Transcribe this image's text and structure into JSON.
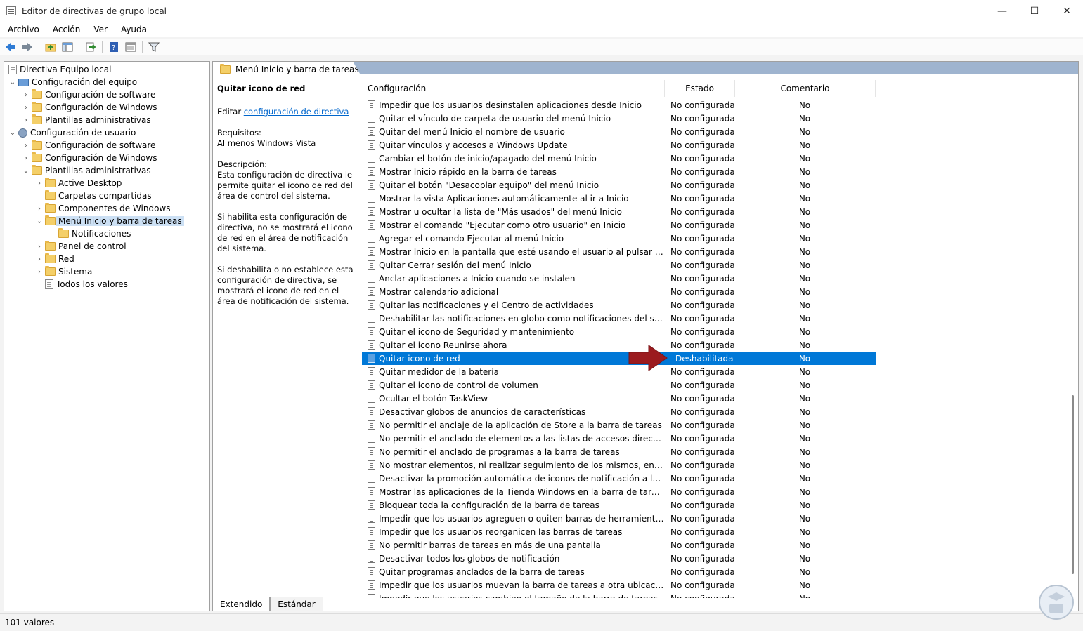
{
  "window": {
    "title": "Editor de directivas de grupo local",
    "minimize": "—",
    "maximize": "☐",
    "close": "✕"
  },
  "menu": [
    "Archivo",
    "Acción",
    "Ver",
    "Ayuda"
  ],
  "tree": [
    {
      "label": "Directiva Equipo local",
      "icon": "document-icon",
      "toggle": ""
    },
    {
      "label": "Configuración del equipo",
      "icon": "computer-icon",
      "toggle": "⌄"
    },
    {
      "label": "Configuración de software",
      "icon": "folder-icon",
      "toggle": "›"
    },
    {
      "label": "Configuración de Windows",
      "icon": "folder-icon",
      "toggle": "›"
    },
    {
      "label": "Plantillas administrativas",
      "icon": "folder-icon",
      "toggle": "›"
    },
    {
      "label": "Configuración de usuario",
      "icon": "user-icon",
      "toggle": "⌄"
    },
    {
      "label": "Configuración de software",
      "icon": "folder-icon",
      "toggle": "›"
    },
    {
      "label": "Configuración de Windows",
      "icon": "folder-icon",
      "toggle": "›"
    },
    {
      "label": "Plantillas administrativas",
      "icon": "folder-icon",
      "toggle": "⌄"
    },
    {
      "label": "Active Desktop",
      "icon": "folder-icon",
      "toggle": "›"
    },
    {
      "label": "Carpetas compartidas",
      "icon": "folder-icon",
      "toggle": ""
    },
    {
      "label": "Componentes de Windows",
      "icon": "folder-icon",
      "toggle": "›"
    },
    {
      "label": "Menú Inicio y barra de tareas",
      "icon": "folder-icon",
      "toggle": "⌄"
    },
    {
      "label": "Notificaciones",
      "icon": "folder-icon",
      "toggle": ""
    },
    {
      "label": "Panel de control",
      "icon": "folder-icon",
      "toggle": "›"
    },
    {
      "label": "Red",
      "icon": "folder-icon",
      "toggle": "›"
    },
    {
      "label": "Sistema",
      "icon": "folder-icon",
      "toggle": "›"
    },
    {
      "label": "Todos los valores",
      "icon": "settings-folder-icon",
      "toggle": ""
    }
  ],
  "panel": {
    "header": "Menú Inicio y barra de tareas",
    "setting_title": "Quitar icono de red",
    "edit_prefix": "Editar",
    "edit_link": "configuración de directiva",
    "requirements_label": "Requisitos:",
    "requirements": "Al menos Windows Vista",
    "description_label": "Descripción:",
    "description1": "Esta configuración de directiva le permite quitar el icono de red del área de control del sistema.",
    "description2": "Si habilita esta configuración de directiva, no se mostrará el icono de red en el área de notificación del sistema.",
    "description3": "Si deshabilita o no establece esta configuración de directiva, se mostrará el icono de red en el área de notificación del sistema."
  },
  "columns": {
    "setting": "Configuración",
    "state": "Estado",
    "comment": "Comentario"
  },
  "rows": [
    {
      "name": "Impedir que los usuarios desinstalen aplicaciones desde Inicio",
      "state": "No configurada",
      "comment": "No"
    },
    {
      "name": "Quitar el vínculo de carpeta de usuario del menú Inicio",
      "state": "No configurada",
      "comment": "No"
    },
    {
      "name": "Quitar del menú Inicio el nombre de usuario",
      "state": "No configurada",
      "comment": "No"
    },
    {
      "name": "Quitar vínculos y accesos a Windows Update",
      "state": "No configurada",
      "comment": "No"
    },
    {
      "name": "Cambiar el botón de inicio/apagado del menú Inicio",
      "state": "No configurada",
      "comment": "No"
    },
    {
      "name": "Mostrar Inicio rápido en la barra de tareas",
      "state": "No configurada",
      "comment": "No"
    },
    {
      "name": "Quitar el botón \"Desacoplar equipo\" del menú Inicio",
      "state": "No configurada",
      "comment": "No"
    },
    {
      "name": "Mostrar la vista Aplicaciones automáticamente al ir a Inicio",
      "state": "No configurada",
      "comment": "No"
    },
    {
      "name": "Mostrar u ocultar la lista de \"Más usados\" del menú Inicio",
      "state": "No configurada",
      "comment": "No"
    },
    {
      "name": "Mostrar el comando \"Ejecutar como otro usuario\" en Inicio",
      "state": "No configurada",
      "comment": "No"
    },
    {
      "name": "Agregar el comando Ejecutar al menú Inicio",
      "state": "No configurada",
      "comment": "No"
    },
    {
      "name": "Mostrar Inicio en la pantalla que esté usando el usuario al pulsar la tecla del...",
      "state": "No configurada",
      "comment": "No"
    },
    {
      "name": "Quitar Cerrar sesión del menú Inicio",
      "state": "No configurada",
      "comment": "No"
    },
    {
      "name": "Anclar aplicaciones a Inicio cuando se instalen",
      "state": "No configurada",
      "comment": "No"
    },
    {
      "name": "Mostrar calendario adicional",
      "state": "No configurada",
      "comment": "No"
    },
    {
      "name": "Quitar las notificaciones y el Centro de actividades",
      "state": "No configurada",
      "comment": "No"
    },
    {
      "name": "Deshabilitar las notificaciones en globo como notificaciones del sistema.",
      "state": "No configurada",
      "comment": "No"
    },
    {
      "name": "Quitar el icono de Seguridad y mantenimiento",
      "state": "No configurada",
      "comment": "No"
    },
    {
      "name": "Quitar el icono Reunirse ahora",
      "state": "No configurada",
      "comment": "No"
    },
    {
      "name": "Quitar icono de red",
      "state": "Deshabilitada",
      "comment": "No",
      "selected": true
    },
    {
      "name": "Quitar medidor de la batería",
      "state": "No configurada",
      "comment": "No"
    },
    {
      "name": "Quitar el icono de control de volumen",
      "state": "No configurada",
      "comment": "No"
    },
    {
      "name": "Ocultar el botón TaskView",
      "state": "No configurada",
      "comment": "No"
    },
    {
      "name": "Desactivar globos de anuncios de características",
      "state": "No configurada",
      "comment": "No"
    },
    {
      "name": "No permitir el anclaje de la aplicación de Store a la barra de tareas",
      "state": "No configurada",
      "comment": "No"
    },
    {
      "name": "No permitir el anclado de elementos a las listas de accesos directos",
      "state": "No configurada",
      "comment": "No"
    },
    {
      "name": "No permitir el anclado de programas a la barra de tareas",
      "state": "No configurada",
      "comment": "No"
    },
    {
      "name": "No mostrar elementos, ni realizar seguimiento de los mismos, en las listas d...",
      "state": "No configurada",
      "comment": "No"
    },
    {
      "name": "Desactivar la promoción automática de iconos de notificación a la barra de ...",
      "state": "No configurada",
      "comment": "No"
    },
    {
      "name": "Mostrar las aplicaciones de la Tienda Windows en la barra de tareas",
      "state": "No configurada",
      "comment": "No"
    },
    {
      "name": "Bloquear toda la configuración de la barra de tareas",
      "state": "No configurada",
      "comment": "No"
    },
    {
      "name": "Impedir que los usuarios agreguen o quiten barras de herramientas",
      "state": "No configurada",
      "comment": "No"
    },
    {
      "name": "Impedir que los usuarios reorganicen las barras de tareas",
      "state": "No configurada",
      "comment": "No"
    },
    {
      "name": "No permitir barras de tareas en más de una pantalla",
      "state": "No configurada",
      "comment": "No"
    },
    {
      "name": "Desactivar todos los globos de notificación",
      "state": "No configurada",
      "comment": "No"
    },
    {
      "name": "Quitar programas anclados de la barra de tareas",
      "state": "No configurada",
      "comment": "No"
    },
    {
      "name": "Impedir que los usuarios muevan la barra de tareas a otra ubicación de aco...",
      "state": "No configurada",
      "comment": "No"
    },
    {
      "name": "Impedir que los usuarios cambien el tamaño de la barra de tareas",
      "state": "No configurada",
      "comment": "No"
    }
  ],
  "tabs": [
    "Extendido",
    "Estándar"
  ],
  "status": "101 valores",
  "colors": {
    "selection": "#0078d7",
    "header_band": "#9fb4cf",
    "arrow": "#9b1b1f"
  },
  "toolbar_icons": [
    "back-icon",
    "forward-icon",
    "up-folder-icon",
    "show-hide-tree-icon",
    "export-list-icon",
    "help-icon",
    "properties-icon",
    "filter-icon"
  ]
}
